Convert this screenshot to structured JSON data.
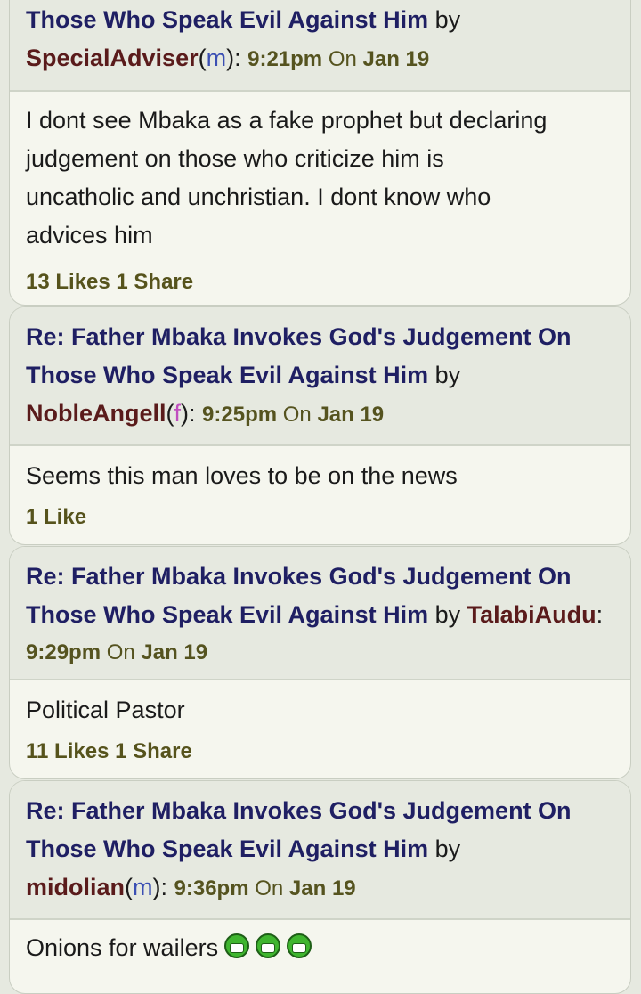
{
  "posts": [
    {
      "title": "Those Who Speak Evil Against Him",
      "by": "by",
      "user": "SpecialAdviser",
      "gender": "m",
      "time": "9:21pm",
      "on": "On",
      "date": "Jan 19",
      "body_lines": [
        "I dont see Mbaka as a fake prophet but declaring",
        "judgement on those who criticize him is",
        "uncatholic and unchristian. I dont know who",
        "advices him"
      ],
      "likes": "13 Likes 1 Share"
    },
    {
      "title_line1": "Re: Father Mbaka Invokes God's Judgement On",
      "title_line2": "Those Who Speak Evil Against Him",
      "by": "by",
      "user": "NobleAngell",
      "gender": "f",
      "time": "9:25pm",
      "on": "On",
      "date": "Jan 19",
      "body": "Seems this man loves to be on the news",
      "likes": "1 Like"
    },
    {
      "title_line1": "Re: Father Mbaka Invokes God's Judgement On",
      "title_line2": "Those Who Speak Evil Against Him",
      "by": "by",
      "user": "TalabiAudu",
      "time": "9:29pm",
      "on": "On",
      "date": "Jan 19",
      "body": "Political Pastor",
      "likes": "11 Likes 1 Share"
    },
    {
      "title_line1": "Re: Father Mbaka Invokes God's Judgement On",
      "title_line2": "Those Who Speak Evil Against Him",
      "by": "by",
      "user": "midolian",
      "gender": "m",
      "time": "9:36pm",
      "on": "On",
      "date": "Jan 19",
      "body": "Onions for wailers",
      "emojis": [
        "grin-icon",
        "grin-icon",
        "grin-icon"
      ]
    }
  ]
}
